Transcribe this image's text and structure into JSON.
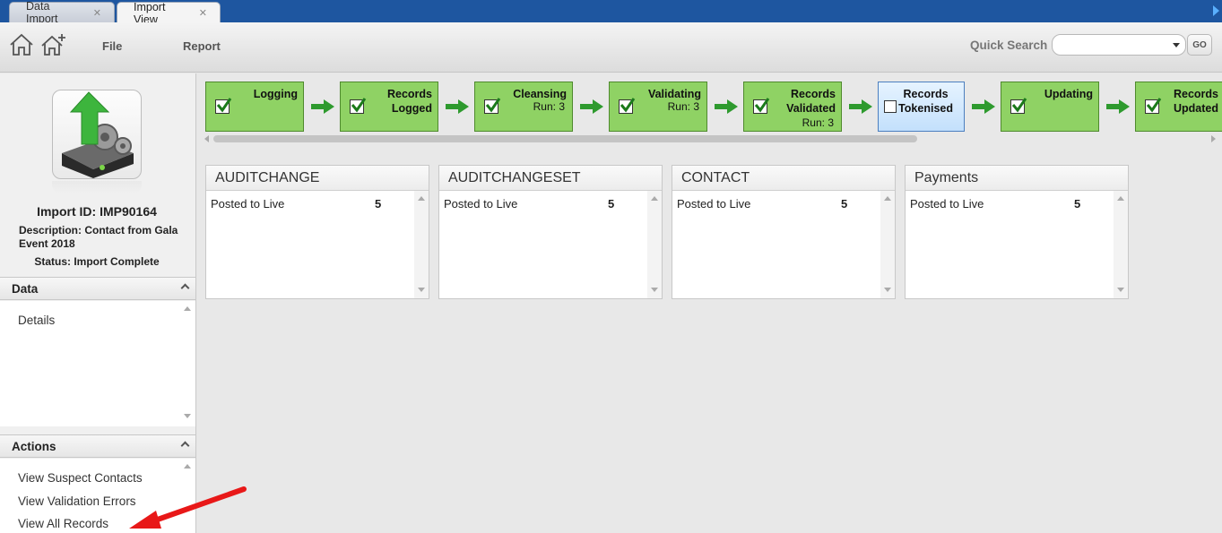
{
  "tabs": [
    {
      "label": "Data Import"
    },
    {
      "label": "Import View"
    }
  ],
  "toolbar": {
    "file_label": "File",
    "report_label": "Report",
    "quick_search_label": "Quick Search",
    "quick_search_value": "",
    "go_label": "GO"
  },
  "import_info": {
    "id_text": "Import ID: IMP90164",
    "description_text": "Description: Contact from Gala Event 2018",
    "status_text": "Status: Import Complete"
  },
  "sections": {
    "data": {
      "title": "Data",
      "items": [
        "Details"
      ]
    },
    "actions": {
      "title": "Actions",
      "items": [
        "View Suspect Contacts",
        "View Validation Errors",
        "View All Records"
      ]
    }
  },
  "steps": [
    {
      "line1": "Logging",
      "line2": "",
      "run": "",
      "done": true
    },
    {
      "line1": "Records",
      "line2": "Logged",
      "run": "",
      "done": true
    },
    {
      "line1": "Cleansing",
      "line2": "",
      "run": "Run: 3",
      "done": true
    },
    {
      "line1": "Validating",
      "line2": "",
      "run": "Run: 3",
      "done": true
    },
    {
      "line1": "Records",
      "line2": "Validated",
      "run": "Run: 3",
      "done": true
    },
    {
      "line1": "Records",
      "line2": "Tokenised",
      "run": "",
      "done": false
    },
    {
      "line1": "Updating",
      "line2": "",
      "run": "",
      "done": true
    },
    {
      "line1": "Records",
      "line2": "Updated",
      "run": "",
      "done": true
    }
  ],
  "cards": [
    {
      "title": "AUDITCHANGE",
      "row_label": "Posted to Live",
      "row_value": "5"
    },
    {
      "title": "AUDITCHANGESET",
      "row_label": "Posted to Live",
      "row_value": "5"
    },
    {
      "title": "CONTACT",
      "row_label": "Posted to Live",
      "row_value": "5"
    },
    {
      "title": "Payments",
      "row_label": "Posted to Live",
      "row_value": "5"
    }
  ],
  "colors": {
    "tab_bar": "#1e56a0",
    "step_done": "#8fd264",
    "step_pending": "#c3e0fc",
    "arrow_green": "#2e9a2e",
    "annotation_red": "#e81818"
  }
}
